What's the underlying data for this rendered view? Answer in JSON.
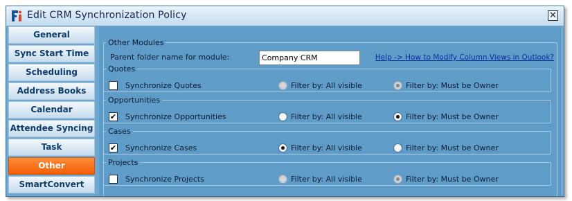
{
  "window": {
    "title": "Edit CRM Synchronization Policy",
    "close_glyph": "✕",
    "logo_icon": "app-logo-icon"
  },
  "sidebar": {
    "items": [
      {
        "label": "General",
        "active": false
      },
      {
        "label": "Sync Start Time",
        "active": false
      },
      {
        "label": "Scheduling",
        "active": false
      },
      {
        "label": "Address Books",
        "active": false
      },
      {
        "label": "Calendar",
        "active": false
      },
      {
        "label": "Attendee Syncing",
        "active": false
      },
      {
        "label": "Task",
        "active": false
      },
      {
        "label": "Other",
        "active": true
      },
      {
        "label": "SmartConvert",
        "active": false
      }
    ]
  },
  "other_modules": {
    "legend": "Other Modules",
    "parent_folder_label": "Parent folder name for module:",
    "parent_folder_value": "Company CRM",
    "help_link": "Help -> How to Modify Column Views in Outlook?",
    "groups": [
      {
        "legend": "Quotes",
        "checkbox_label": "Synchronize Quotes",
        "checked": false,
        "filter_all_label": "Filter by: All visible",
        "filter_owner_label": "Filter by: Must be Owner",
        "selected_filter": "owner",
        "filters_enabled": false
      },
      {
        "legend": "Opportunities",
        "checkbox_label": "Synchronize Opportunities",
        "checked": true,
        "filter_all_label": "Filter by: All visible",
        "filter_owner_label": "Filter by: Must be Owner",
        "selected_filter": "owner",
        "filters_enabled": true
      },
      {
        "legend": "Cases",
        "checkbox_label": "Synchronize Cases",
        "checked": true,
        "filter_all_label": "Filter by: All visible",
        "filter_owner_label": "Filter by: Must be Owner",
        "selected_filter": "all",
        "filters_enabled": true
      },
      {
        "legend": "Projects",
        "checkbox_label": "Synchronize Projects",
        "checked": false,
        "filter_all_label": "Filter by: All visible",
        "filter_owner_label": "Filter by: Must be Owner",
        "selected_filter": "owner",
        "filters_enabled": false
      }
    ]
  },
  "colors": {
    "panel_bg": "#6ea7cf",
    "active_tab": "#f55e05",
    "link": "#0e2b9e"
  }
}
